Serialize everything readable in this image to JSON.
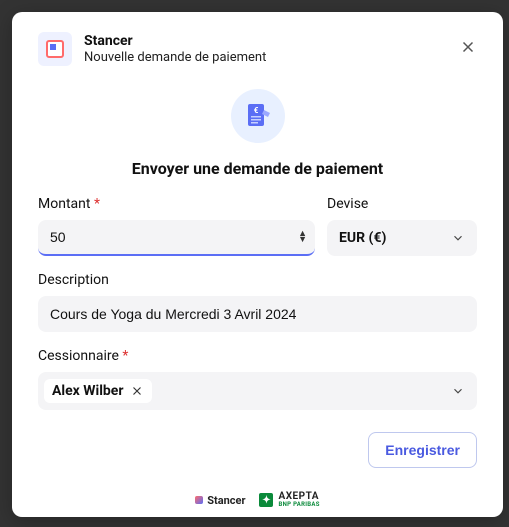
{
  "header": {
    "brand": "Stancer",
    "subtitle": "Nouvelle demande de paiement"
  },
  "hero": {
    "title": "Envoyer une demande de paiement"
  },
  "form": {
    "amount_label": "Montant",
    "amount_value": "50",
    "currency_label": "Devise",
    "currency_value": "EUR (€)",
    "description_label": "Description",
    "description_value": "Cours de Yoga du Mercredi 3 Avril 2024",
    "assignee_label": "Cessionnaire",
    "assignee_chip": "Alex Wilber"
  },
  "actions": {
    "save": "Enregistrer"
  },
  "footer": {
    "stancer": "Stancer",
    "axepta_line1": "AXEPTA",
    "axepta_line2": "BNP PARIBAS"
  },
  "required_mark": "*"
}
